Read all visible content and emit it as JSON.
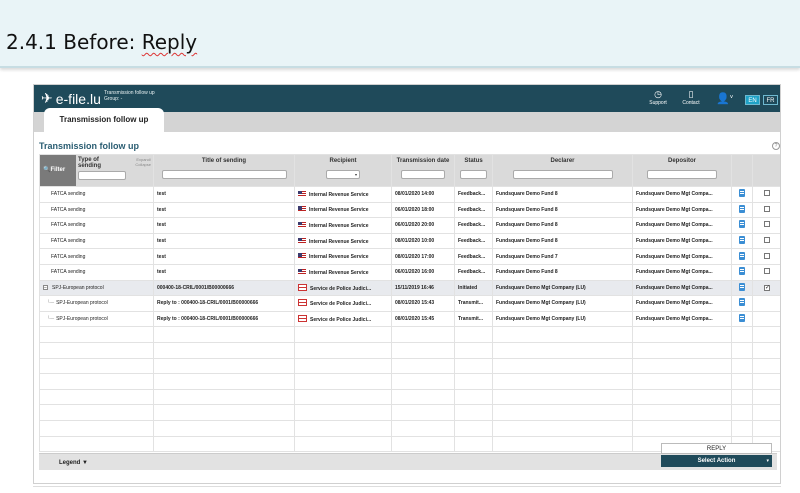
{
  "slide": {
    "title_prefix": "2.4.1 Before: ",
    "title_word": "Reply"
  },
  "app": {
    "logo_text": "e-file.lu",
    "context_title": "Transmission follow up",
    "context_group": "Group: -",
    "support_label": "Support",
    "contact_label": "Contact",
    "lang_en": "EN",
    "lang_fr": "FR",
    "tab_label": "Transmission follow up",
    "section_title": "Transmission follow up",
    "help_symbol": "?"
  },
  "table": {
    "filter_label": "Filter",
    "expand_label": "Expand/",
    "collapse_label": "Collapse",
    "headers": [
      "Type of sending",
      "Title of sending",
      "Recipient",
      "Transmission date",
      "Status",
      "Declarer",
      "Depositor"
    ],
    "rows": [
      {
        "type": "FATCA sending",
        "title": "test",
        "recipient": "Internal Revenue Service",
        "date": "08/01/2020 14:00",
        "status": "Feedback...",
        "declarer": "Fundsquare Demo Fund 8",
        "depositor": "Fundsquare Demo Mgt Compa...",
        "checked": false,
        "flag": "us"
      },
      {
        "type": "FATCA sending",
        "title": "test",
        "recipient": "Internal Revenue Service",
        "date": "06/01/2020 18:00",
        "status": "Feedback...",
        "declarer": "Fundsquare Demo Fund 8",
        "depositor": "Fundsquare Demo Mgt Compa...",
        "checked": false,
        "flag": "us"
      },
      {
        "type": "FATCA sending",
        "title": "test",
        "recipient": "Internal Revenue Service",
        "date": "06/01/2020 20:00",
        "status": "Feedback...",
        "declarer": "Fundsquare Demo Fund 8",
        "depositor": "Fundsquare Demo Mgt Compa...",
        "checked": false,
        "flag": "us"
      },
      {
        "type": "FATCA sending",
        "title": "test",
        "recipient": "Internal Revenue Service",
        "date": "08/01/2020 10:00",
        "status": "Feedback...",
        "declarer": "Fundsquare Demo Fund 8",
        "depositor": "Fundsquare Demo Mgt Compa...",
        "checked": false,
        "flag": "us"
      },
      {
        "type": "FATCA sending",
        "title": "test",
        "recipient": "Internal Revenue Service",
        "date": "08/01/2020 17:00",
        "status": "Feedback...",
        "declarer": "Fundsquare Demo Fund 7",
        "depositor": "Fundsquare Demo Mgt Compa...",
        "checked": false,
        "flag": "us"
      },
      {
        "type": "FATCA sending",
        "title": "test",
        "recipient": "Internal Revenue Service",
        "date": "06/01/2020 16:00",
        "status": "Feedback...",
        "declarer": "Fundsquare Demo Fund 8",
        "depositor": "Fundsquare Demo Mgt Compa...",
        "checked": false,
        "flag": "us"
      },
      {
        "type": "SPJ-European protocol",
        "title": "000400-18-CRIL/0001/B00000666",
        "recipient": "Service de Police Judici...",
        "date": "15/11/2019 16:46",
        "status": "Initiated",
        "declarer": "Fundsquare Demo Mgt Company (LU)",
        "depositor": "Fundsquare Demo Mgt Compa...",
        "checked": true,
        "flag": "mail",
        "selected": true,
        "expander": "-"
      },
      {
        "type": "SPJ-European protocol",
        "title": "Reply to : 000400-18-CRIL/0001/B00000666",
        "recipient": "Service de Police Judici...",
        "date": "08/01/2020 15:43",
        "status": "Transmit...",
        "declarer": "Fundsquare Demo Mgt Company (LU)",
        "depositor": "Fundsquare Demo Mgt Compa...",
        "checked": null,
        "flag": "mail",
        "child": true
      },
      {
        "type": "SPJ-European protocol",
        "title": "Reply to : 000400-18-CRIL/0001/B00000666",
        "recipient": "Service de Police Judici...",
        "date": "08/01/2020 15:45",
        "status": "Transmit...",
        "declarer": "Fundsquare Demo Mgt Company (LU)",
        "depositor": "Fundsquare Demo Mgt Compa...",
        "checked": null,
        "flag": "mail",
        "child": true
      }
    ],
    "empty_rows": 8
  },
  "footer": {
    "legend_label": "Legend",
    "reply_option": "REPLY",
    "select_action_label": "Select Action"
  },
  "colors": {
    "header_bar": "#1f4a5a",
    "accent": "#1fa2c6",
    "selected_text": "#1b9bb5"
  }
}
